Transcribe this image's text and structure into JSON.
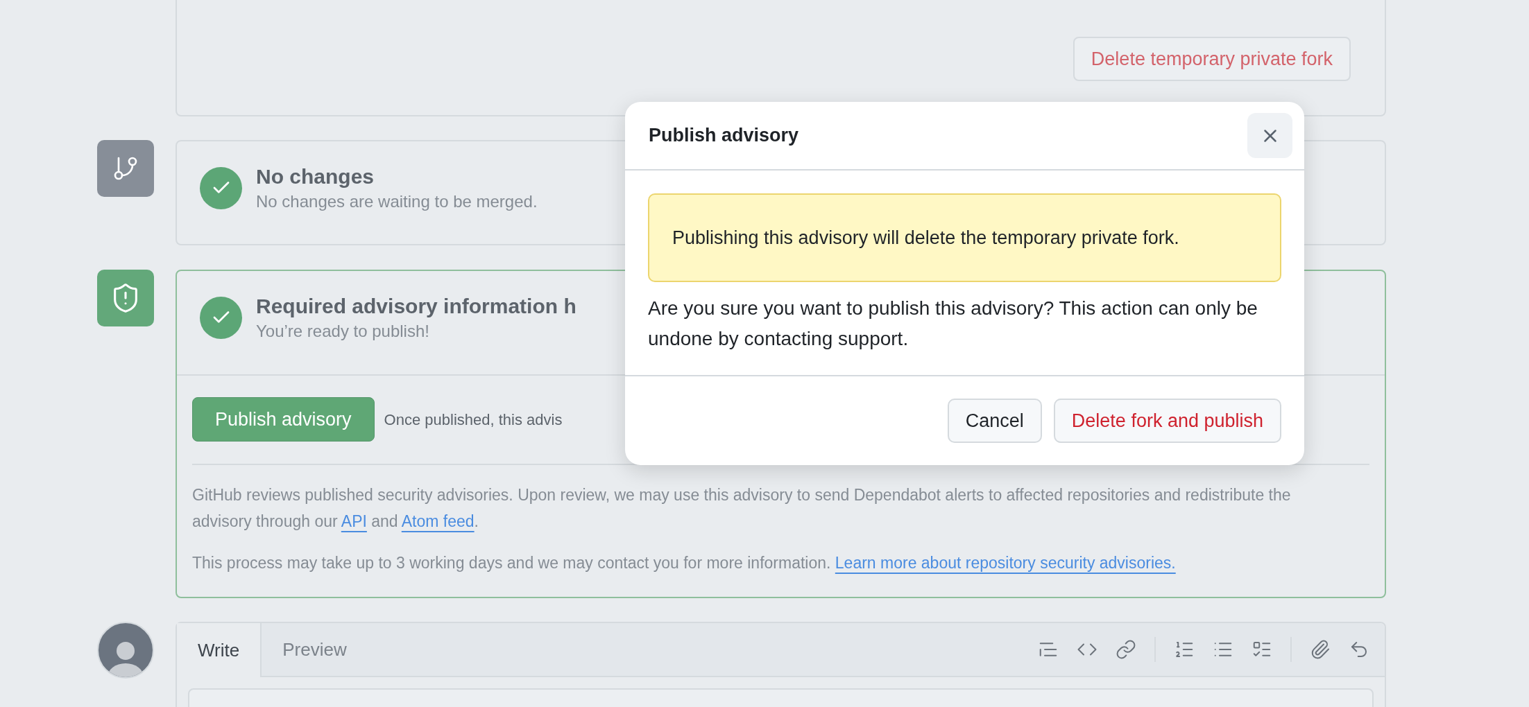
{
  "top_card": {
    "delete_fork_button": "Delete temporary private fork"
  },
  "timeline": [
    {
      "kind": "branch",
      "complete": true,
      "title": "No changes",
      "subtitle": "No changes are waiting to be merged."
    },
    {
      "kind": "shield",
      "complete": true,
      "title": "Required advisory information h",
      "subtitle": "You’re ready to publish!",
      "publish_button": "Publish advisory",
      "publish_note": "Once published, this advis",
      "info": [
        [
          {
            "text": "GitHub reviews published security advisories. Upon review, we may use this advisory to send Dependabot alerts to affected repositories and redistribute the advisory through our "
          },
          {
            "text": "API",
            "kind": "link"
          },
          {
            "text": " and "
          },
          {
            "text": "Atom feed",
            "kind": "link"
          },
          {
            "text": "."
          }
        ],
        [
          {
            "text": "This process may take up to 3 working days and we may contact you for more information. "
          },
          {
            "text": "Learn more about repository security advisories.",
            "kind": "link"
          }
        ]
      ]
    }
  ],
  "editor": {
    "tabs": [
      {
        "label": "Write",
        "selected": true
      },
      {
        "label": "Preview",
        "selected": false
      }
    ]
  },
  "dialog": {
    "title": "Publish advisory",
    "warning": "Publishing this advisory will delete the temporary private fork.",
    "message": "Are you sure you want to publish this advisory? This action can only be undone by contacting support.",
    "buttons": [
      {
        "label": "Cancel",
        "kind": "default"
      },
      {
        "label": "Delete fork and publish",
        "kind": "danger"
      }
    ]
  }
}
